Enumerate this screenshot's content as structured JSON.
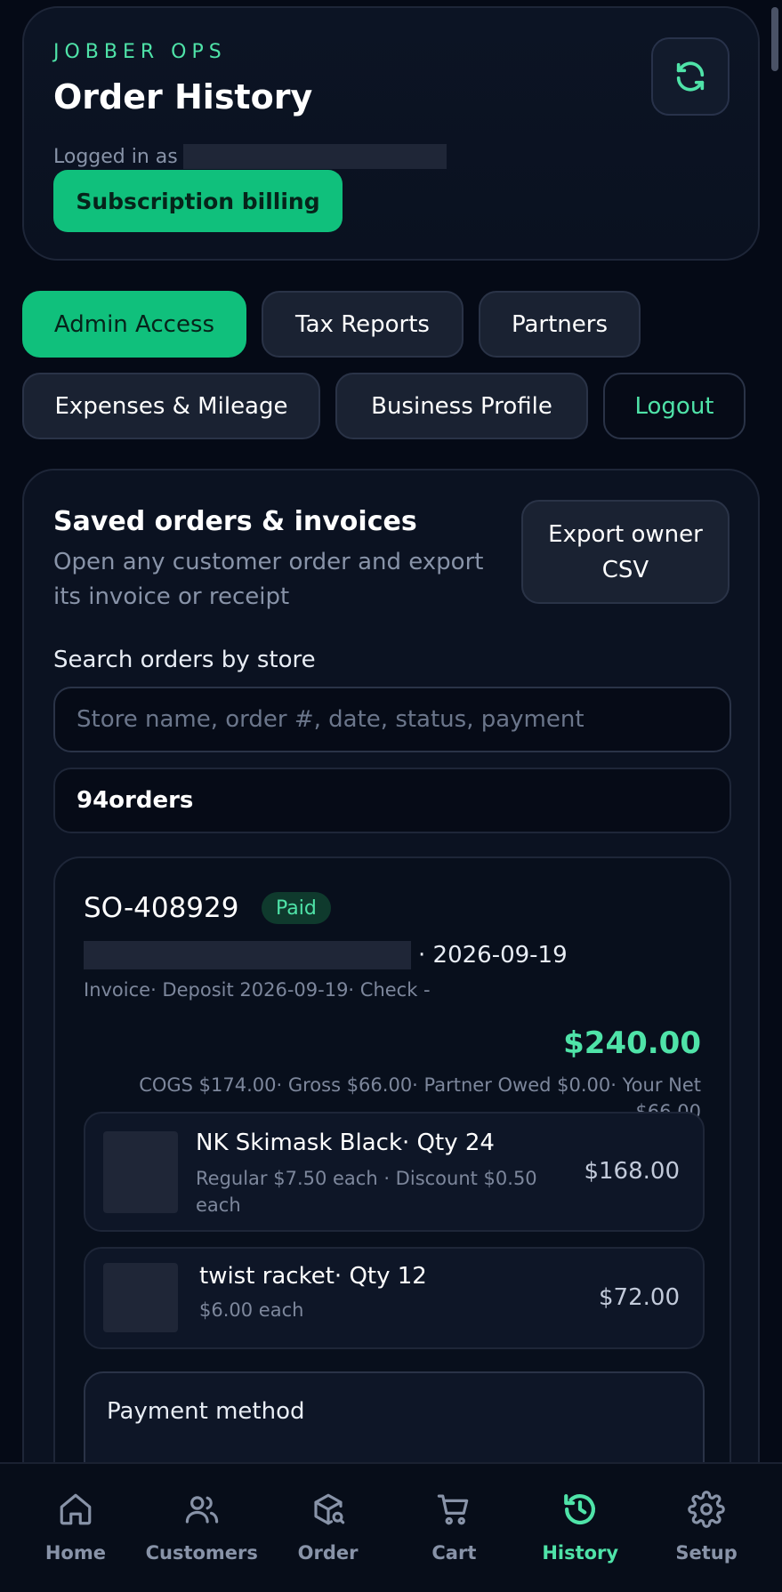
{
  "header": {
    "brand": "JOBBER OPS",
    "title": "Order History",
    "logged_in_label": "Logged in as",
    "subscription_button": "Subscription billing",
    "refresh_icon": "refresh-icon"
  },
  "tabs": [
    {
      "label": "Admin Access",
      "active": true
    },
    {
      "label": "Tax Reports",
      "active": false
    },
    {
      "label": "Partners",
      "active": false
    },
    {
      "label": "Expenses & Mileage",
      "active": false
    },
    {
      "label": "Business Profile",
      "active": false
    },
    {
      "label": "Logout",
      "active": false
    }
  ],
  "saved": {
    "title": "Saved orders & invoices",
    "subtitle": "Open any customer order and export its invoice or receipt",
    "export_button": "Export owner CSV",
    "search_label": "Search orders by store",
    "search_placeholder": "Store name, order #, date, status, payment",
    "count_text": "94orders"
  },
  "order": {
    "id": "SO-408929",
    "status": "Paid",
    "date_suffix": "· 2026-09-19",
    "meta": "Invoice· Deposit 2026-09-19· Check -",
    "total": "$240.00",
    "breakdown": "COGS $174.00· Gross $66.00· Partner Owed $0.00· Your Net $66.00",
    "items": [
      {
        "name": "NK Skimask Black· Qty 24",
        "desc": "Regular $7.50 each · Discount $0.50 each",
        "price": "$168.00"
      },
      {
        "name": "twist racket· Qty 12",
        "desc": "$6.00 each",
        "price": "$72.00"
      }
    ],
    "payment_label": "Payment method"
  },
  "nav": [
    {
      "label": "Home",
      "icon": "home-icon",
      "active": false
    },
    {
      "label": "Customers",
      "icon": "users-icon",
      "active": false
    },
    {
      "label": "Order",
      "icon": "package-search-icon",
      "active": false
    },
    {
      "label": "Cart",
      "icon": "cart-icon",
      "active": false
    },
    {
      "label": "History",
      "icon": "history-icon",
      "active": true
    },
    {
      "label": "Setup",
      "icon": "gear-icon",
      "active": false
    }
  ],
  "colors": {
    "accent": "#10c07c",
    "accent_text": "#4fe3a8",
    "background": "#050a16"
  }
}
